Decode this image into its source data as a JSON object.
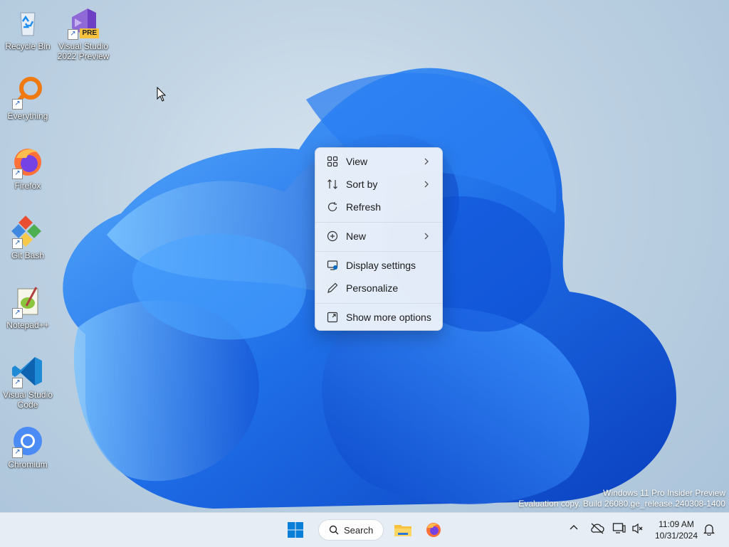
{
  "desktop": {
    "icons": [
      {
        "label_line1": "Recycle Bin",
        "label_line2": ""
      },
      {
        "label_line1": "Visual Studio",
        "label_line2": "2022 Preview",
        "badge": "PRE"
      },
      {
        "label_line1": "Everything",
        "label_line2": ""
      },
      {
        "label_line1": "Firefox",
        "label_line2": ""
      },
      {
        "label_line1": "Git Bash",
        "label_line2": ""
      },
      {
        "label_line1": "Notepad++",
        "label_line2": ""
      },
      {
        "label_line1": "Visual Studio",
        "label_line2": "Code"
      },
      {
        "label_line1": "Chromium",
        "label_line2": ""
      }
    ]
  },
  "context_menu": {
    "items": [
      {
        "label": "View",
        "icon": "grid-icon",
        "has_submenu": true
      },
      {
        "label": "Sort by",
        "icon": "sort-icon",
        "has_submenu": true
      },
      {
        "label": "Refresh",
        "icon": "refresh-icon",
        "has_submenu": false
      },
      {
        "label": "New",
        "icon": "plus-circle-icon",
        "has_submenu": true
      },
      {
        "label": "Display settings",
        "icon": "display-icon",
        "has_submenu": false
      },
      {
        "label": "Personalize",
        "icon": "pen-icon",
        "has_submenu": false
      },
      {
        "label": "Show more options",
        "icon": "expand-icon",
        "has_submenu": false
      }
    ]
  },
  "watermark": {
    "line1": "Windows 11 Pro Insider Preview",
    "line2": "Evaluation copy. Build 26080.ge_release.240308-1400"
  },
  "taskbar": {
    "search_label": "Search",
    "clock_time": "11:09 AM",
    "clock_date": "10/31/2024"
  },
  "colors": {
    "accent": "#0067c0",
    "wallpaper_blue": "#1f6fe8"
  }
}
